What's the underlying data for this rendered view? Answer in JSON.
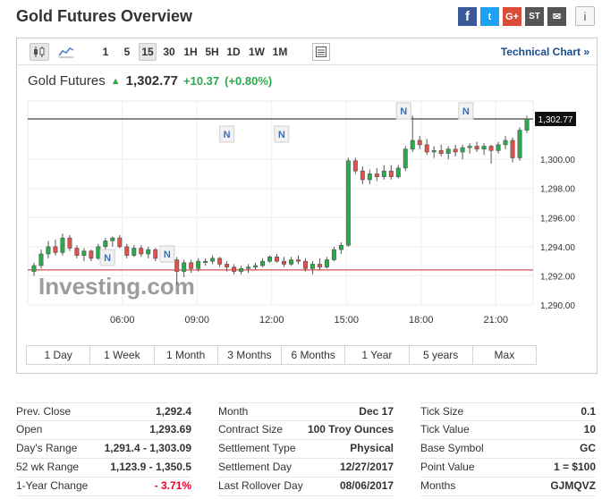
{
  "page": {
    "title": "Gold Futures Overview"
  },
  "social": {
    "facebook": "f",
    "twitter": "t",
    "google": "G+",
    "stocktwits": "ST",
    "mail": "✉",
    "info": "i"
  },
  "toolbar": {
    "intervals": [
      "1",
      "5",
      "15",
      "30",
      "1H",
      "5H",
      "1D",
      "1W",
      "1M"
    ],
    "active_interval": "15",
    "technical_chart_label": "Technical Chart »"
  },
  "quote": {
    "name": "Gold Futures",
    "price": "1,302.77",
    "change": "+10.37",
    "change_pct": "(+0.80%)"
  },
  "chart_data": {
    "type": "candlestick",
    "watermark": "Investing.com",
    "last_price_label": "1,302.77",
    "last_price": 1302.77,
    "prev_close": 1292.4,
    "ylim": [
      1290,
      1304
    ],
    "yticks": [
      1290,
      1292,
      1294,
      1296,
      1298,
      1300
    ],
    "ytick_labels": [
      "1,290.00",
      "1,292.00",
      "1,294.00",
      "1,296.00",
      "1,298.00",
      "1,300.00"
    ],
    "xticks": [
      "06:00",
      "09:00",
      "12:00",
      "15:00",
      "18:00",
      "21:00"
    ],
    "x_hours": [
      6,
      9,
      12,
      15,
      18,
      21
    ],
    "x_start_hour": 2.2,
    "x_end_hour": 22.5,
    "news_markers_hours": [
      5.4,
      7.8,
      10.2,
      12.4,
      17.3,
      19.8
    ],
    "news_label": "N",
    "candles": [
      {
        "o": 1292.3,
        "h": 1292.9,
        "l": 1292.0,
        "c": 1292.7
      },
      {
        "o": 1292.7,
        "h": 1293.8,
        "l": 1292.5,
        "c": 1293.5
      },
      {
        "o": 1293.5,
        "h": 1294.4,
        "l": 1293.2,
        "c": 1294.0
      },
      {
        "o": 1294.0,
        "h": 1294.5,
        "l": 1293.4,
        "c": 1293.6
      },
      {
        "o": 1293.6,
        "h": 1294.9,
        "l": 1293.4,
        "c": 1294.6
      },
      {
        "o": 1294.6,
        "h": 1294.8,
        "l": 1293.7,
        "c": 1293.9
      },
      {
        "o": 1293.9,
        "h": 1294.1,
        "l": 1293.2,
        "c": 1293.4
      },
      {
        "o": 1293.4,
        "h": 1293.9,
        "l": 1293.0,
        "c": 1293.7
      },
      {
        "o": 1293.7,
        "h": 1293.8,
        "l": 1293.0,
        "c": 1293.2
      },
      {
        "o": 1293.2,
        "h": 1294.2,
        "l": 1293.1,
        "c": 1294.0
      },
      {
        "o": 1294.0,
        "h": 1294.6,
        "l": 1293.8,
        "c": 1294.4
      },
      {
        "o": 1294.4,
        "h": 1294.7,
        "l": 1294.0,
        "c": 1294.6
      },
      {
        "o": 1294.6,
        "h": 1294.8,
        "l": 1293.9,
        "c": 1294.0
      },
      {
        "o": 1294.0,
        "h": 1294.2,
        "l": 1293.2,
        "c": 1293.4
      },
      {
        "o": 1293.4,
        "h": 1294.1,
        "l": 1293.3,
        "c": 1293.9
      },
      {
        "o": 1293.9,
        "h": 1294.1,
        "l": 1293.3,
        "c": 1293.5
      },
      {
        "o": 1293.5,
        "h": 1294.0,
        "l": 1293.2,
        "c": 1293.8
      },
      {
        "o": 1293.8,
        "h": 1293.9,
        "l": 1293.0,
        "c": 1293.2
      },
      {
        "o": 1293.2,
        "h": 1293.6,
        "l": 1292.9,
        "c": 1293.4
      },
      {
        "o": 1293.4,
        "h": 1293.6,
        "l": 1292.9,
        "c": 1293.1
      },
      {
        "o": 1293.1,
        "h": 1293.3,
        "l": 1291.4,
        "c": 1292.3
      },
      {
        "o": 1292.3,
        "h": 1293.1,
        "l": 1291.9,
        "c": 1292.9
      },
      {
        "o": 1292.9,
        "h": 1293.1,
        "l": 1292.2,
        "c": 1292.5
      },
      {
        "o": 1292.5,
        "h": 1293.2,
        "l": 1292.3,
        "c": 1293.0
      },
      {
        "o": 1293.0,
        "h": 1293.2,
        "l": 1292.7,
        "c": 1293.0
      },
      {
        "o": 1293.0,
        "h": 1293.4,
        "l": 1292.8,
        "c": 1293.2
      },
      {
        "o": 1293.2,
        "h": 1293.3,
        "l": 1292.6,
        "c": 1292.8
      },
      {
        "o": 1292.8,
        "h": 1293.0,
        "l": 1292.3,
        "c": 1292.6
      },
      {
        "o": 1292.6,
        "h": 1292.8,
        "l": 1292.1,
        "c": 1292.3
      },
      {
        "o": 1292.3,
        "h": 1292.7,
        "l": 1292.1,
        "c": 1292.5
      },
      {
        "o": 1292.5,
        "h": 1292.8,
        "l": 1292.2,
        "c": 1292.6
      },
      {
        "o": 1292.6,
        "h": 1292.9,
        "l": 1292.4,
        "c": 1292.7
      },
      {
        "o": 1292.7,
        "h": 1293.2,
        "l": 1292.6,
        "c": 1293.0
      },
      {
        "o": 1293.0,
        "h": 1293.4,
        "l": 1292.9,
        "c": 1293.3
      },
      {
        "o": 1293.3,
        "h": 1293.5,
        "l": 1292.9,
        "c": 1293.0
      },
      {
        "o": 1293.0,
        "h": 1293.3,
        "l": 1292.6,
        "c": 1292.8
      },
      {
        "o": 1292.8,
        "h": 1293.3,
        "l": 1292.7,
        "c": 1293.1
      },
      {
        "o": 1293.1,
        "h": 1293.4,
        "l": 1292.8,
        "c": 1293.0
      },
      {
        "o": 1293.0,
        "h": 1293.2,
        "l": 1292.3,
        "c": 1292.5
      },
      {
        "o": 1292.5,
        "h": 1293.0,
        "l": 1292.1,
        "c": 1292.8
      },
      {
        "o": 1292.8,
        "h": 1293.2,
        "l": 1292.4,
        "c": 1292.6
      },
      {
        "o": 1292.6,
        "h": 1293.3,
        "l": 1292.5,
        "c": 1293.1
      },
      {
        "o": 1293.1,
        "h": 1294.0,
        "l": 1293.0,
        "c": 1293.8
      },
      {
        "o": 1293.8,
        "h": 1294.3,
        "l": 1293.5,
        "c": 1294.1
      },
      {
        "o": 1294.1,
        "h": 1300.1,
        "l": 1294.0,
        "c": 1299.9
      },
      {
        "o": 1299.9,
        "h": 1300.1,
        "l": 1299.0,
        "c": 1299.2
      },
      {
        "o": 1299.2,
        "h": 1299.5,
        "l": 1298.3,
        "c": 1298.6
      },
      {
        "o": 1298.6,
        "h": 1299.3,
        "l": 1298.3,
        "c": 1299.0
      },
      {
        "o": 1299.0,
        "h": 1299.4,
        "l": 1298.5,
        "c": 1298.8
      },
      {
        "o": 1298.8,
        "h": 1299.6,
        "l": 1298.6,
        "c": 1299.2
      },
      {
        "o": 1299.2,
        "h": 1299.6,
        "l": 1298.6,
        "c": 1298.8
      },
      {
        "o": 1298.8,
        "h": 1299.6,
        "l": 1298.7,
        "c": 1299.4
      },
      {
        "o": 1299.4,
        "h": 1300.9,
        "l": 1299.2,
        "c": 1300.7
      },
      {
        "o": 1300.7,
        "h": 1303.0,
        "l": 1300.5,
        "c": 1301.3
      },
      {
        "o": 1301.3,
        "h": 1301.6,
        "l": 1300.7,
        "c": 1301.0
      },
      {
        "o": 1301.0,
        "h": 1301.4,
        "l": 1300.3,
        "c": 1300.5
      },
      {
        "o": 1300.5,
        "h": 1300.9,
        "l": 1300.1,
        "c": 1300.6
      },
      {
        "o": 1300.6,
        "h": 1301.0,
        "l": 1300.2,
        "c": 1300.4
      },
      {
        "o": 1300.4,
        "h": 1300.9,
        "l": 1300.0,
        "c": 1300.7
      },
      {
        "o": 1300.7,
        "h": 1301.0,
        "l": 1300.2,
        "c": 1300.5
      },
      {
        "o": 1300.5,
        "h": 1301.0,
        "l": 1300.0,
        "c": 1300.8
      },
      {
        "o": 1300.8,
        "h": 1301.1,
        "l": 1300.4,
        "c": 1300.9
      },
      {
        "o": 1300.9,
        "h": 1301.2,
        "l": 1300.5,
        "c": 1300.7
      },
      {
        "o": 1300.7,
        "h": 1301.1,
        "l": 1300.3,
        "c": 1300.9
      },
      {
        "o": 1300.9,
        "h": 1301.0,
        "l": 1299.7,
        "c": 1300.6
      },
      {
        "o": 1300.6,
        "h": 1301.2,
        "l": 1300.4,
        "c": 1301.0
      },
      {
        "o": 1301.0,
        "h": 1301.6,
        "l": 1300.7,
        "c": 1301.3
      },
      {
        "o": 1301.3,
        "h": 1301.5,
        "l": 1299.8,
        "c": 1300.1
      },
      {
        "o": 1300.1,
        "h": 1302.2,
        "l": 1299.9,
        "c": 1302.0
      },
      {
        "o": 1302.0,
        "h": 1303.0,
        "l": 1301.8,
        "c": 1302.77
      }
    ]
  },
  "ranges": [
    "1 Day",
    "1 Week",
    "1 Month",
    "3 Months",
    "6 Months",
    "1 Year",
    "5 years",
    "Max"
  ],
  "stats": {
    "col1": [
      {
        "label": "Prev. Close",
        "value": "1,292.4"
      },
      {
        "label": "Open",
        "value": "1,293.69"
      },
      {
        "label": "Day's Range",
        "value": "1,291.4 - 1,303.09"
      },
      {
        "label": "52 wk Range",
        "value": "1,123.9 - 1,350.5"
      },
      {
        "label": "1-Year Change",
        "value": "- 3.71%",
        "negative": true
      }
    ],
    "col2": [
      {
        "label": "Month",
        "value": "Dec 17"
      },
      {
        "label": "Contract Size",
        "value": "100 Troy Ounces"
      },
      {
        "label": "Settlement Type",
        "value": "Physical"
      },
      {
        "label": "Settlement Day",
        "value": "12/27/2017"
      },
      {
        "label": "Last Rollover Day",
        "value": "08/06/2017"
      }
    ],
    "col3": [
      {
        "label": "Tick Size",
        "value": "0.1"
      },
      {
        "label": "Tick Value",
        "value": "10"
      },
      {
        "label": "Base Symbol",
        "value": "GC"
      },
      {
        "label": "Point Value",
        "value": "1 = $100"
      },
      {
        "label": "Months",
        "value": "GJMQVZ"
      }
    ]
  },
  "colors": {
    "up": "#2da84e",
    "down": "#d9534f",
    "link": "#1b4e8c",
    "prev_close_line": "#c62828"
  }
}
